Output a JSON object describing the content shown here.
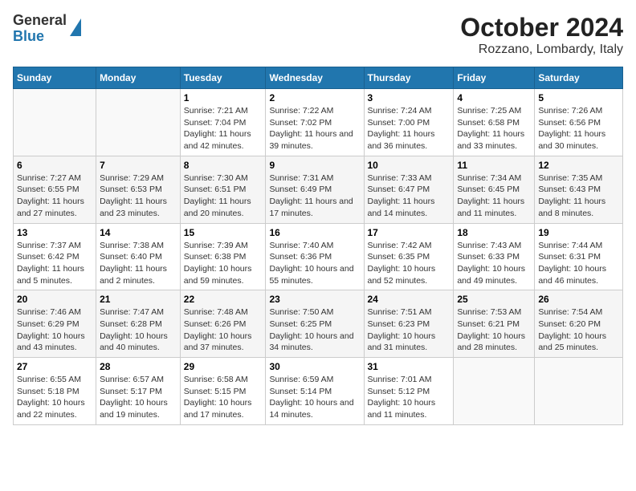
{
  "logo": {
    "general": "General",
    "blue": "Blue"
  },
  "title": "October 2024",
  "subtitle": "Rozzano, Lombardy, Italy",
  "days_of_week": [
    "Sunday",
    "Monday",
    "Tuesday",
    "Wednesday",
    "Thursday",
    "Friday",
    "Saturday"
  ],
  "weeks": [
    [
      {
        "day": "",
        "info": ""
      },
      {
        "day": "",
        "info": ""
      },
      {
        "day": "1",
        "info": "Sunrise: 7:21 AM\nSunset: 7:04 PM\nDaylight: 11 hours and 42 minutes."
      },
      {
        "day": "2",
        "info": "Sunrise: 7:22 AM\nSunset: 7:02 PM\nDaylight: 11 hours and 39 minutes."
      },
      {
        "day": "3",
        "info": "Sunrise: 7:24 AM\nSunset: 7:00 PM\nDaylight: 11 hours and 36 minutes."
      },
      {
        "day": "4",
        "info": "Sunrise: 7:25 AM\nSunset: 6:58 PM\nDaylight: 11 hours and 33 minutes."
      },
      {
        "day": "5",
        "info": "Sunrise: 7:26 AM\nSunset: 6:56 PM\nDaylight: 11 hours and 30 minutes."
      }
    ],
    [
      {
        "day": "6",
        "info": "Sunrise: 7:27 AM\nSunset: 6:55 PM\nDaylight: 11 hours and 27 minutes."
      },
      {
        "day": "7",
        "info": "Sunrise: 7:29 AM\nSunset: 6:53 PM\nDaylight: 11 hours and 23 minutes."
      },
      {
        "day": "8",
        "info": "Sunrise: 7:30 AM\nSunset: 6:51 PM\nDaylight: 11 hours and 20 minutes."
      },
      {
        "day": "9",
        "info": "Sunrise: 7:31 AM\nSunset: 6:49 PM\nDaylight: 11 hours and 17 minutes."
      },
      {
        "day": "10",
        "info": "Sunrise: 7:33 AM\nSunset: 6:47 PM\nDaylight: 11 hours and 14 minutes."
      },
      {
        "day": "11",
        "info": "Sunrise: 7:34 AM\nSunset: 6:45 PM\nDaylight: 11 hours and 11 minutes."
      },
      {
        "day": "12",
        "info": "Sunrise: 7:35 AM\nSunset: 6:43 PM\nDaylight: 11 hours and 8 minutes."
      }
    ],
    [
      {
        "day": "13",
        "info": "Sunrise: 7:37 AM\nSunset: 6:42 PM\nDaylight: 11 hours and 5 minutes."
      },
      {
        "day": "14",
        "info": "Sunrise: 7:38 AM\nSunset: 6:40 PM\nDaylight: 11 hours and 2 minutes."
      },
      {
        "day": "15",
        "info": "Sunrise: 7:39 AM\nSunset: 6:38 PM\nDaylight: 10 hours and 59 minutes."
      },
      {
        "day": "16",
        "info": "Sunrise: 7:40 AM\nSunset: 6:36 PM\nDaylight: 10 hours and 55 minutes."
      },
      {
        "day": "17",
        "info": "Sunrise: 7:42 AM\nSunset: 6:35 PM\nDaylight: 10 hours and 52 minutes."
      },
      {
        "day": "18",
        "info": "Sunrise: 7:43 AM\nSunset: 6:33 PM\nDaylight: 10 hours and 49 minutes."
      },
      {
        "day": "19",
        "info": "Sunrise: 7:44 AM\nSunset: 6:31 PM\nDaylight: 10 hours and 46 minutes."
      }
    ],
    [
      {
        "day": "20",
        "info": "Sunrise: 7:46 AM\nSunset: 6:29 PM\nDaylight: 10 hours and 43 minutes."
      },
      {
        "day": "21",
        "info": "Sunrise: 7:47 AM\nSunset: 6:28 PM\nDaylight: 10 hours and 40 minutes."
      },
      {
        "day": "22",
        "info": "Sunrise: 7:48 AM\nSunset: 6:26 PM\nDaylight: 10 hours and 37 minutes."
      },
      {
        "day": "23",
        "info": "Sunrise: 7:50 AM\nSunset: 6:25 PM\nDaylight: 10 hours and 34 minutes."
      },
      {
        "day": "24",
        "info": "Sunrise: 7:51 AM\nSunset: 6:23 PM\nDaylight: 10 hours and 31 minutes."
      },
      {
        "day": "25",
        "info": "Sunrise: 7:53 AM\nSunset: 6:21 PM\nDaylight: 10 hours and 28 minutes."
      },
      {
        "day": "26",
        "info": "Sunrise: 7:54 AM\nSunset: 6:20 PM\nDaylight: 10 hours and 25 minutes."
      }
    ],
    [
      {
        "day": "27",
        "info": "Sunrise: 6:55 AM\nSunset: 5:18 PM\nDaylight: 10 hours and 22 minutes."
      },
      {
        "day": "28",
        "info": "Sunrise: 6:57 AM\nSunset: 5:17 PM\nDaylight: 10 hours and 19 minutes."
      },
      {
        "day": "29",
        "info": "Sunrise: 6:58 AM\nSunset: 5:15 PM\nDaylight: 10 hours and 17 minutes."
      },
      {
        "day": "30",
        "info": "Sunrise: 6:59 AM\nSunset: 5:14 PM\nDaylight: 10 hours and 14 minutes."
      },
      {
        "day": "31",
        "info": "Sunrise: 7:01 AM\nSunset: 5:12 PM\nDaylight: 10 hours and 11 minutes."
      },
      {
        "day": "",
        "info": ""
      },
      {
        "day": "",
        "info": ""
      }
    ]
  ]
}
